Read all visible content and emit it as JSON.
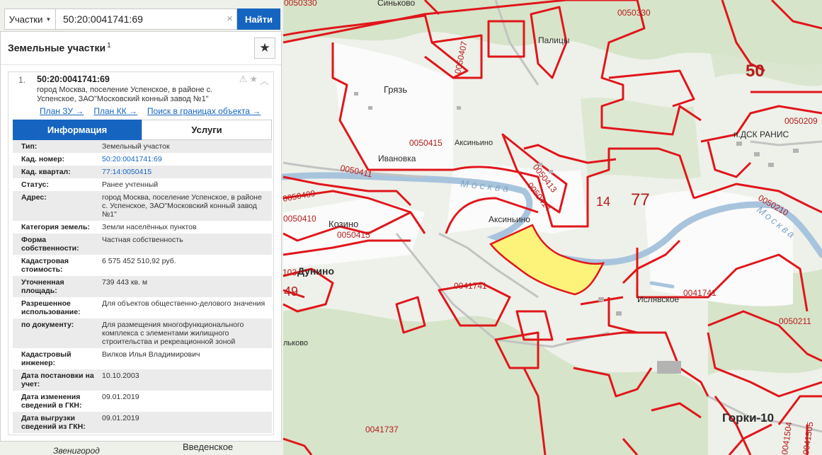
{
  "search": {
    "type_label": "Участки",
    "query": "50:20:0041741:69",
    "find_label": "Найти",
    "clear_glyph": "×"
  },
  "panel": {
    "title": "Земельные участки",
    "title_count": "1",
    "favorite_icon": "star-icon"
  },
  "result": {
    "index": "1.",
    "cadastral_number": "50:20:0041741:69",
    "address": "город Москва, поселение Успенское, в районе с. Успенское, ЗАО\"Московский конный завод №1\"",
    "links": [
      "План ЗУ →",
      "План КК →",
      "Поиск в границах объекта →"
    ],
    "tabs": [
      "Информация",
      "Услуги"
    ],
    "active_tab": "Информация",
    "properties": [
      {
        "label": "Тип:",
        "value": "Земельный участок"
      },
      {
        "label": "Кад. номер:",
        "value": "50:20:0041741:69",
        "link": true
      },
      {
        "label": "Кад. квартал:",
        "value": "77:14:0050415",
        "link": true
      },
      {
        "label": "Статус:",
        "value": "Ранее учтенный"
      },
      {
        "label": "Адрес:",
        "value": "город Москва, поселение Успенское, в районе с. Успенское, ЗАО\"Московский конный завод №1\""
      },
      {
        "label": "Категория земель:",
        "value": "Земли населённых пунктов"
      },
      {
        "label": "Форма собственности:",
        "value": "Частная собственность"
      },
      {
        "label": "Кадастровая стоимость:",
        "value": "6 575 452 510,92 руб."
      },
      {
        "label": "Уточненная площадь:",
        "value": "739 443 кв. м"
      },
      {
        "label": "Разрешенное использование:",
        "value": "Для объектов общественно-делового значения"
      },
      {
        "label": "по документу:",
        "value": "Для размещения многофункционального комплекса с элементами жилищного строительства и рекреационной зоной"
      },
      {
        "label": "Кадастровый инженер:",
        "value": "Вилков Илья Владимирович"
      },
      {
        "label": "Дата постановки на учет:",
        "value": "10.10.2003"
      },
      {
        "label": "Дата изменения сведений в ГКН:",
        "value": "09.01.2019"
      },
      {
        "label": "Дата выгрузки сведений из ГКН:",
        "value": "09.01.2019"
      }
    ]
  },
  "map": {
    "colors": {
      "boundary": "#e0161b",
      "highlight": "#fdf27a",
      "river": "#a8c4dd",
      "forest": "#d4e3c6",
      "road": "#c8c8c8"
    },
    "place_labels": [
      "Синьково",
      "Палицы",
      "Грязь",
      "Ивановка",
      "Аксиньино",
      "Аксиньино",
      "Козино",
      "Дунино",
      "Ислявское",
      "п.ДСК РАНИС",
      "Горки-10",
      "Введенское",
      "льково",
      "Звенигород"
    ],
    "river_labels": [
      "Москва",
      "Москва"
    ],
    "cadastral_labels": [
      "0050330",
      "0050330",
      "0050407",
      "0050415",
      "0050411",
      "0050413",
      "0050414",
      "0050409",
      "0050410",
      "0050415",
      "0041741",
      "0041741",
      "0050209",
      "0050210",
      "0050211",
      "0041737",
      "0041504",
      "0041505",
      "103"
    ],
    "district_labels": [
      "50",
      "14",
      "77",
      "49"
    ]
  }
}
